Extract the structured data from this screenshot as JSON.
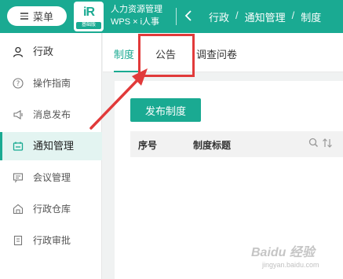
{
  "header": {
    "menu_label": "菜单",
    "logo_mark": "iR",
    "logo_edition": "基础版",
    "app_name_line1": "人力资源管理",
    "app_name_line2": "WPS × i人事",
    "breadcrumb": [
      "行政",
      "通知管理",
      "制度"
    ],
    "breadcrumb_sep": "/"
  },
  "sidebar": {
    "items": [
      {
        "label": "行政",
        "icon": "person-icon"
      },
      {
        "label": "操作指南",
        "icon": "help-circle-icon"
      },
      {
        "label": "消息发布",
        "icon": "megaphone-icon"
      },
      {
        "label": "通知管理",
        "icon": "notice-icon"
      },
      {
        "label": "会议管理",
        "icon": "meeting-icon"
      },
      {
        "label": "行政仓库",
        "icon": "warehouse-icon"
      },
      {
        "label": "行政审批",
        "icon": "approval-icon"
      }
    ],
    "active_index": 3
  },
  "tabs": [
    {
      "label": "制度",
      "active": true
    },
    {
      "label": "公告",
      "active": false
    },
    {
      "label": "调查问卷",
      "active": false
    }
  ],
  "main": {
    "publish_button": "发布制度",
    "columns": [
      "序号",
      "制度标题"
    ]
  },
  "watermark": {
    "main": "Baidu 经验",
    "sub": "jingyan.baidu.com"
  },
  "colors": {
    "brand": "#1aaa92",
    "annotation": "#e13a3a"
  }
}
